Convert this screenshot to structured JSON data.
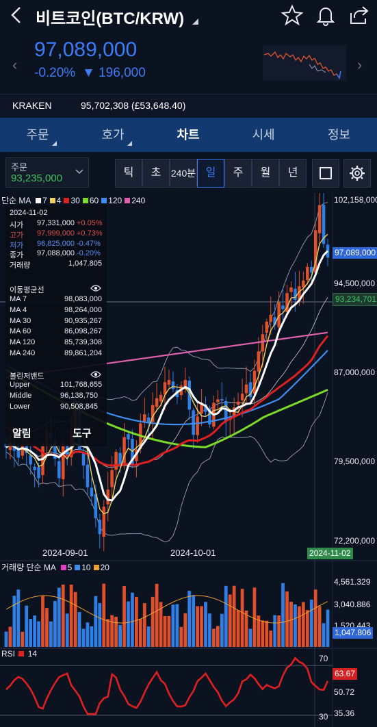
{
  "header": {
    "title": "비트코인(BTC/KRW)",
    "icons": [
      "back-arrow-icon",
      "star-icon",
      "bell-icon",
      "share-icon"
    ]
  },
  "ticker": {
    "price": "97,089,000",
    "change_pct": "-0.20%",
    "change_amt": "▼ 196,000",
    "color": "#3d7cf5"
  },
  "exchange": {
    "name": "KRAKEN",
    "price": "95,702,308 (£53,648.40)"
  },
  "tabs": [
    "주문",
    "호가",
    "차트",
    "시세",
    "정보"
  ],
  "active_tab": "차트",
  "order": {
    "label": "주문",
    "value": "93,235,000"
  },
  "periods": [
    "틱",
    "초",
    "240분",
    "일",
    "주",
    "월",
    "년"
  ],
  "active_period": "일",
  "legend": {
    "prefix": "단순 MA",
    "items": [
      "7",
      "4",
      "30",
      "60",
      "120",
      "240"
    ],
    "colors": [
      "#ffffff",
      "#f0d060",
      "#e02020",
      "#7ddc2a",
      "#3d8ef0",
      "#e060b0"
    ]
  },
  "info": {
    "date": "2024-11-02",
    "ohlc": [
      {
        "label": "시가",
        "value": "97,331,000",
        "pct": "+0.05%",
        "color": "#e8ecf4",
        "pcolor": "#e05050"
      },
      {
        "label": "고가",
        "value": "97,999,000",
        "pct": "+0.73%",
        "color": "#e05050",
        "pcolor": "#e05050"
      },
      {
        "label": "저가",
        "value": "96,825,000",
        "pct": "-0.47%",
        "color": "#5b8ef5",
        "pcolor": "#5b8ef5"
      },
      {
        "label": "종가",
        "value": "97,088,000",
        "pct": "-0.20%",
        "color": "#e8ecf4",
        "pcolor": "#5b8ef5"
      }
    ],
    "volume_label": "거래량",
    "volume_value": "1,047.805",
    "ma_title": "이동평균선",
    "mas": [
      {
        "label": "MA 7",
        "value": "98,083,000"
      },
      {
        "label": "MA 4",
        "value": "98,264,000"
      },
      {
        "label": "MA 30",
        "value": "90,935,267"
      },
      {
        "label": "MA 60",
        "value": "86,098,267"
      },
      {
        "label": "MA 120",
        "value": "85,739,308"
      },
      {
        "label": "MA 240",
        "value": "89,861,204"
      }
    ],
    "bb_title": "볼린저밴드",
    "bb": [
      {
        "label": "Upper",
        "value": "101,768,655"
      },
      {
        "label": "Middle",
        "value": "96,138,750"
      },
      {
        "label": "Lower",
        "value": "90,508,845"
      }
    ],
    "alarm": "알림",
    "tool": "도구",
    "bb_legend_fragment": "Middle  Lower"
  },
  "price_axis": {
    "labels": [
      "102,158,000",
      "94,500,000",
      "87,000,000",
      "79,500,000",
      "72,200,000"
    ],
    "current": "97,089,000",
    "crosshair": "93,234,701"
  },
  "date_axis": {
    "labels": [
      "2024-09-01",
      "2024-10-01"
    ],
    "current": "2024-11-02"
  },
  "volume_panel": {
    "prefix": "거래량 단순 MA",
    "items": [
      "5",
      "10",
      "20"
    ],
    "colors": [
      "#e040c0",
      "#3d8ef0",
      "#f0a030"
    ],
    "labels": [
      "4,561.329",
      "3,040.886",
      "1,520.443"
    ],
    "current": "1,047.806"
  },
  "rsi_panel": {
    "label": "RSI",
    "period": "14",
    "labels": [
      "70",
      "50.72",
      "35.36",
      "30"
    ],
    "current": "63.67"
  },
  "chart_data": {
    "type": "candlestick",
    "x_start": "2024-07-25",
    "x_end": "2024-11-02",
    "ylim": [
      72200000,
      102158000
    ],
    "close": [
      80.5,
      81.0,
      80.2,
      79.6,
      80.8,
      80.0,
      79.0,
      78.5,
      77.8,
      80.6,
      82.0,
      81.2,
      79.5,
      77.8,
      80.9,
      79.8,
      82.0,
      84.5,
      80.3,
      78.9,
      77.0,
      76.2,
      74.3,
      72.9,
      75.3,
      76.8,
      78.5,
      80.1,
      79.0,
      81.4,
      81.2,
      79.0,
      80.3,
      82.6,
      83.4,
      82.6,
      84.2,
      84.8,
      85.1,
      86.2,
      86.4,
      85.6,
      84.9,
      85.9,
      86.4,
      83.8,
      81.6,
      83.2,
      84.4,
      83.6,
      82.5,
      84.4,
      84.7,
      84.6,
      82.8,
      83.0,
      84.0,
      84.5,
      85.2,
      86.0,
      84.9,
      87.2,
      88.9,
      90.4,
      91.5,
      92.1,
      91.2,
      93.2,
      92.6,
      94.0,
      94.5,
      93.4,
      94.6,
      95.1,
      96.3,
      95.8,
      99.5,
      101.7,
      98.3,
      97.1
    ]
  }
}
